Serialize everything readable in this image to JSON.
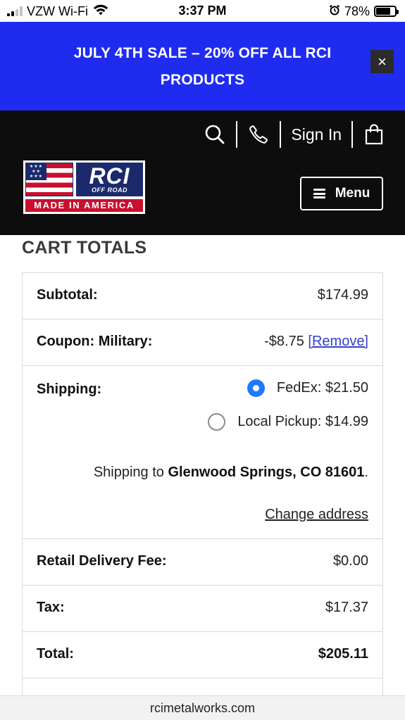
{
  "status_bar": {
    "carrier": "VZW Wi-Fi",
    "time": "3:37 PM",
    "battery": "78%",
    "battery_level": 0.78,
    "icons": [
      "signal-icon",
      "wifi-icon",
      "alarm-icon",
      "battery-icon"
    ]
  },
  "promo": {
    "text": "JULY 4TH SALE – 20% OFF ALL RCI PRODUCTS",
    "close_label": "×"
  },
  "header": {
    "sign_in": "Sign In",
    "menu_label": "Menu",
    "logo": {
      "brand": "RCI",
      "sub": "OFF ROAD",
      "tagline": "MADE IN AMERICA"
    }
  },
  "cart": {
    "title": "CART TOTALS",
    "subtotal_label": "Subtotal:",
    "subtotal_value": "$174.99",
    "coupon_label": "Coupon: Military:",
    "coupon_value": "-$8.75",
    "coupon_remove": "[Remove]",
    "shipping_label": "Shipping:",
    "shipping_options": [
      {
        "label": "FedEx: $21.50",
        "selected": true
      },
      {
        "label": "Local Pickup: $14.99",
        "selected": false
      }
    ],
    "shipping_to_prefix": "Shipping to ",
    "shipping_to_location": "Glenwood Springs, CO 81601",
    "shipping_to_suffix": ".",
    "change_address": "Change address",
    "delivery_fee_label": "Retail Delivery Fee:",
    "delivery_fee_value": "$0.00",
    "tax_label": "Tax:",
    "tax_value": "$17.37",
    "total_label": "Total:",
    "total_value": "$205.11"
  },
  "browser": {
    "url": "rcimetalworks.com"
  },
  "colors": {
    "promo_bg": "#1f2cf0",
    "header_bg": "#0d0d0d",
    "link": "#3343c9",
    "radio_selected": "#1f7aff",
    "logo_navy": "#1a2a6c",
    "logo_red": "#c8102e"
  }
}
